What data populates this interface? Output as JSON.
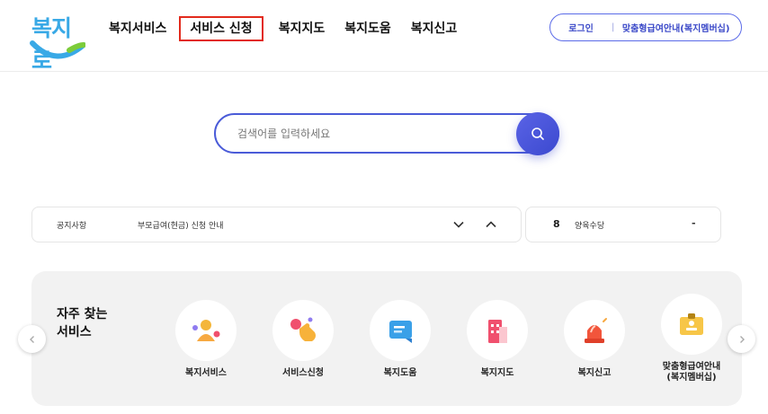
{
  "header": {
    "logo_text": "복지로",
    "nav": [
      "복지서비스",
      "서비스 신청",
      "복지지도",
      "복지도움",
      "복지신고"
    ],
    "active_nav_index": 1,
    "login_label": "로그인",
    "separator": "|",
    "custom_label": "맞춤형급여안내(복지멤버십)"
  },
  "search": {
    "placeholder": "검색어를 입력하세요"
  },
  "notice": {
    "label": "공지사항",
    "text": "부모급여(현금) 신청 안내"
  },
  "ranking": {
    "rank": "8",
    "keyword": "양육수당",
    "change": "-"
  },
  "frequent": {
    "title_line1": "자주 찾는",
    "title_line2": "서비스",
    "items": [
      {
        "label": "복지서비스",
        "icon": "person-icon"
      },
      {
        "label": "서비스신청",
        "icon": "hand-click-icon"
      },
      {
        "label": "복지도움",
        "icon": "chat-card-icon"
      },
      {
        "label": "복지지도",
        "icon": "building-icon"
      },
      {
        "label": "복지신고",
        "icon": "siren-icon"
      },
      {
        "label": "맞춤형급여안내\n(복지멤버십)",
        "label_line1": "맞춤형급여안내",
        "label_line2": "(복지멤버십)",
        "icon": "id-card-icon"
      }
    ]
  },
  "colors": {
    "accent": "#4a5bd8",
    "highlight_border": "#e22a1c",
    "logo_blue": "#39a9e6"
  }
}
